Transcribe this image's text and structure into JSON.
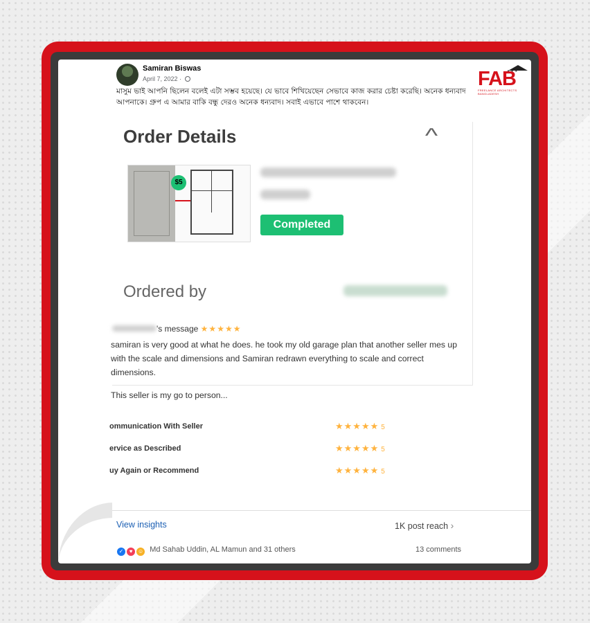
{
  "post": {
    "author": "Samiran Biswas",
    "date": "April 7, 2022 ·",
    "more_label": "···",
    "text": "মাসুম ভাই আপনি ছিলেন বলেই এটা সম্ভব হয়েছে। যে ভাবে শিখিয়েছেন সেভাবে কাজ করার চেষ্টা করেছি। অনেক ধন্যবাদ আপনাকে। গ্রুপ এ আমার বাকি বন্ধু দেরও অনেক ধন্যবাদ। সবাই এভাবে পাশে থাকবেন।"
  },
  "order": {
    "title": "Order Details",
    "price_badge": "$5",
    "status": "Completed",
    "ordered_by_label": "Ordered by",
    "message_suffix": "'s message",
    "message_stars": "★★★★★",
    "message_body": "samiran is very good at what he does. he took my old garage plan that another seller mes up with the scale and dimensions and Samiran redrawn everything to scale and correct dimensions.",
    "message_closing": "This seller is my go to person...",
    "ratings": [
      {
        "label": "ommunication With Seller",
        "stars": "★★★★★",
        "value": "5"
      },
      {
        "label": "ervice as Described",
        "stars": "★★★★★",
        "value": "5"
      },
      {
        "label": "uy Again or Recommend",
        "stars": "★★★★★",
        "value": "5"
      }
    ]
  },
  "footer": {
    "insights": "View insights",
    "reach": "1K post reach",
    "reactions": "Md Sahab Uddin, AL Mamun and 31 others",
    "comments": "13 comments"
  },
  "logo": {
    "text": "FAB",
    "sub": "FREELANCE ARCHITECTS BANGLADESH"
  },
  "colors": {
    "frame_red": "#d6121b",
    "fiverr_green": "#1dbf73",
    "star": "#ffb33e",
    "link_blue": "#1b5fb3"
  }
}
